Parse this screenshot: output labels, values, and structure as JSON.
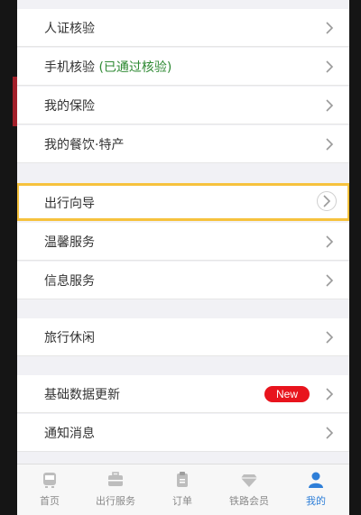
{
  "menu_group_1": [
    {
      "label": "人证核验",
      "status": ""
    },
    {
      "label": "手机核验",
      "status": "(已通过核验)"
    },
    {
      "label": "我的保险",
      "status": ""
    },
    {
      "label": "我的餐饮·特产",
      "status": ""
    }
  ],
  "menu_group_2": [
    {
      "label": "出行向导",
      "highlighted": true
    },
    {
      "label": "温馨服务"
    },
    {
      "label": "信息服务"
    }
  ],
  "menu_group_3": [
    {
      "label": "旅行休闲"
    }
  ],
  "menu_group_4": [
    {
      "label": "基础数据更新",
      "badge": "New"
    },
    {
      "label": "通知消息"
    }
  ],
  "tabbar": {
    "items": [
      {
        "label": "首页",
        "icon": "train-icon"
      },
      {
        "label": "出行服务",
        "icon": "briefcase-icon"
      },
      {
        "label": "订单",
        "icon": "order-clipboard-icon"
      },
      {
        "label": "铁路会员",
        "icon": "diamond-icon"
      },
      {
        "label": "我的",
        "icon": "person-icon"
      }
    ],
    "active_index": 4
  },
  "colors": {
    "highlight_border": "#f6c23d",
    "verified_green": "#2f8a34",
    "badge_red": "#e8141d",
    "active_tab_blue": "#2f7fd8"
  }
}
